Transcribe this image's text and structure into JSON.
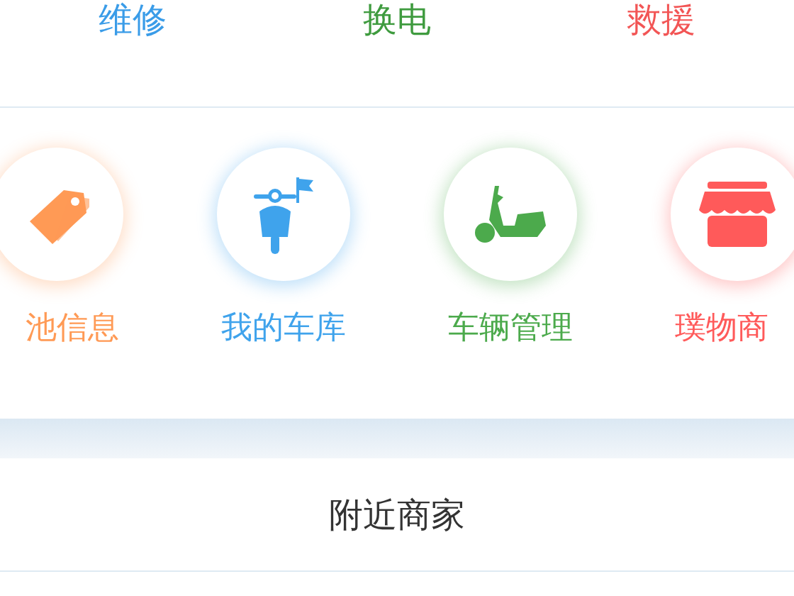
{
  "top_actions": [
    {
      "label": "维修",
      "color": "#3a9ce8"
    },
    {
      "label": "换电",
      "color": "#3f9b3f"
    },
    {
      "label": "救援",
      "color": "#f25555"
    }
  ],
  "shortcuts": [
    {
      "label": "池信息",
      "kind": "tag",
      "color": "#ff9a55"
    },
    {
      "label": "我的车库",
      "kind": "front-scooter",
      "color": "#3fa3ec"
    },
    {
      "label": "车辆管理",
      "kind": "scooter",
      "color": "#4caa4c"
    },
    {
      "label": "璞物商",
      "kind": "shop",
      "color": "#ff5a5a"
    }
  ],
  "section_title": "附近商家"
}
